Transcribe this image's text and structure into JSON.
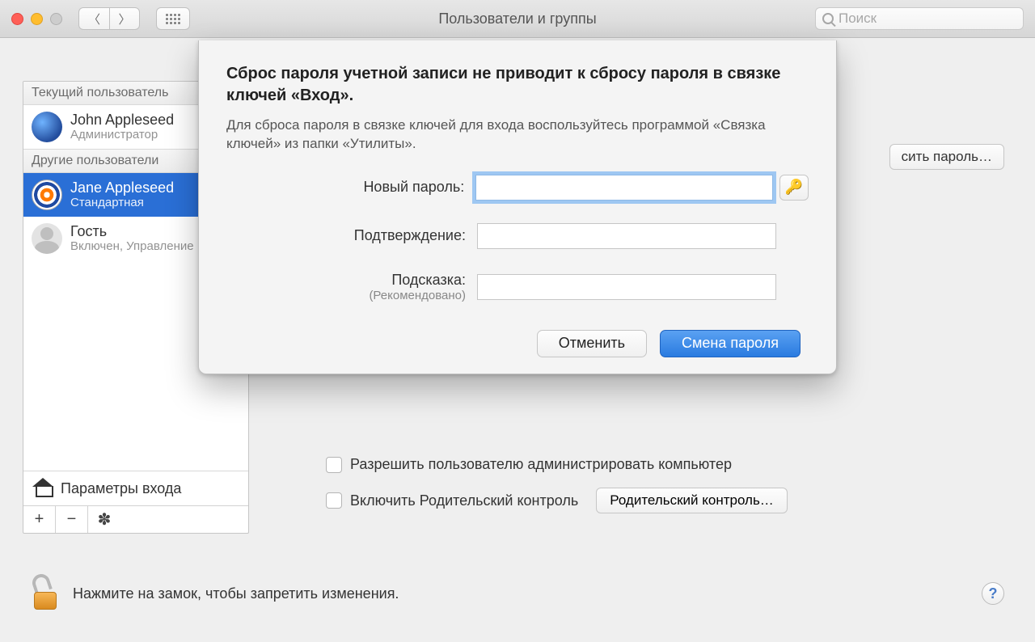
{
  "window": {
    "title": "Пользователи и группы",
    "search_placeholder": "Поиск"
  },
  "sidebar": {
    "section_current": "Текущий пользователь",
    "section_others": "Другие пользователи",
    "users": [
      {
        "name": "John Appleseed",
        "role": "Администратор",
        "avatar": "earth",
        "selected": false
      },
      {
        "name": "Jane Appleseed",
        "role": "Стандартная",
        "avatar": "target",
        "selected": true
      },
      {
        "name": "Гость",
        "role": "Включен, Управление",
        "avatar": "silhouette",
        "selected": false
      }
    ],
    "login_options": "Параметры входа",
    "footer_add": "+",
    "footer_remove": "−",
    "footer_settings": "✽"
  },
  "rpanel": {
    "reset_password_peek": "сить пароль…",
    "allow_admin": "Разрешить пользователю администрировать компьютер",
    "parental_enable": "Включить Родительский контроль",
    "parental_open": "Родительский контроль…"
  },
  "lock_row": {
    "text": "Нажмите на замок, чтобы запретить изменения.",
    "help": "?"
  },
  "dialog": {
    "title": "Сброс пароля учетной записи не приводит к сбросу пароля в связке ключей «Вход».",
    "subtitle": "Для сброса пароля в связке ключей для входа воспользуйтесь программой «Связка ключей» из папки «Утилиты».",
    "labels": {
      "new_password": "Новый пароль:",
      "confirm": "Подтверждение:",
      "hint": "Подсказка:",
      "hint_sub": "(Рекомендовано)"
    },
    "key_icon": "🔑",
    "buttons": {
      "cancel": "Отменить",
      "change": "Смена пароля"
    }
  }
}
